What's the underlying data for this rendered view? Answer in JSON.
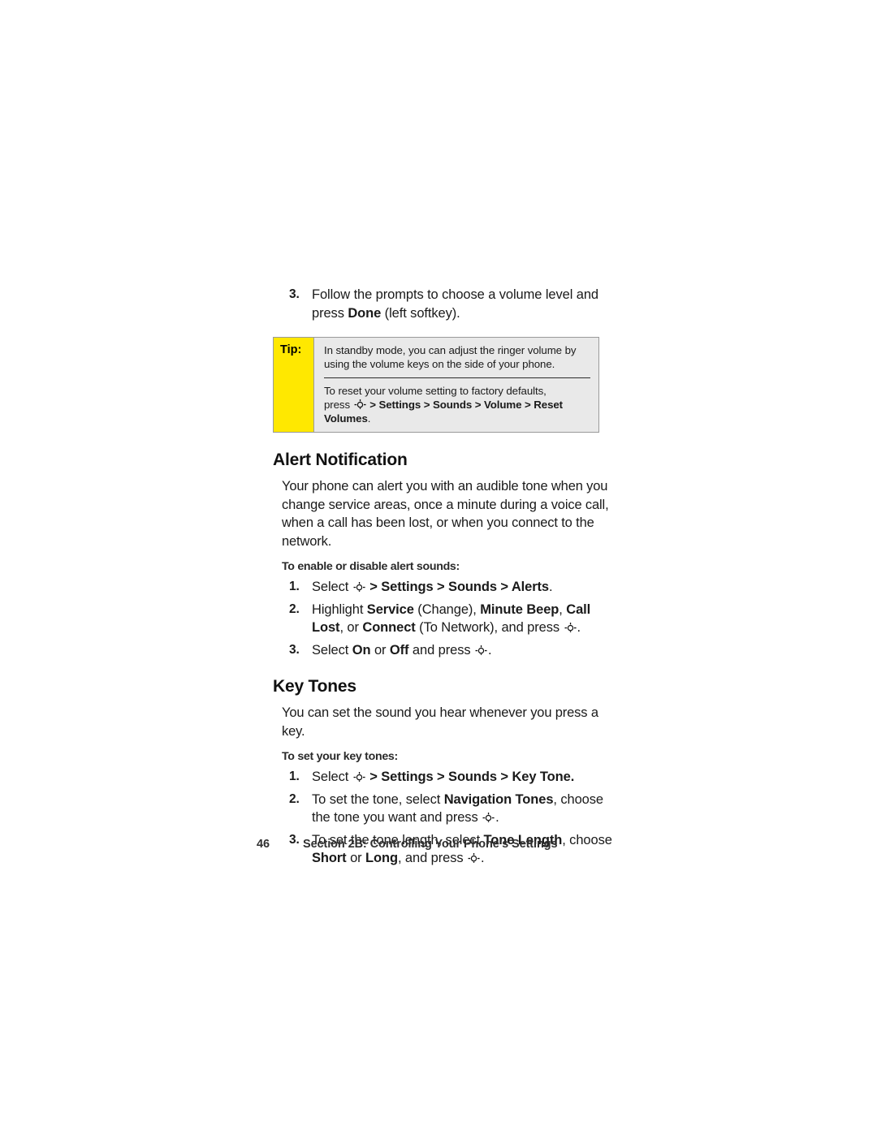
{
  "page": {
    "number": "46",
    "footer_text": "Section 2B: Controlling Your Phone’s Settings",
    "nav_icon_name": "navigation-key-icon"
  },
  "top_step": {
    "num": "3.",
    "line1": "Follow the prompts to choose a volume level and press ",
    "bold1": "Done",
    "line2": " (left softkey)."
  },
  "tip": {
    "label": "Tip:",
    "para1": "In standby mode, you can adjust the ringer volume by using the volume keys on the side of your phone.",
    "para2_pre": "To reset your volume setting to factory defaults,",
    "para2_press": "press ",
    "para2_path": " > Settings > Sounds > Volume > Reset Volumes",
    "para2_end": "."
  },
  "alert": {
    "heading": "Alert Notification",
    "body": "Your phone can alert you with an audible tone when you change service areas, once a minute during a voice call, when a call has been lost, or when you connect to the network.",
    "subhead": "To enable or disable alert sounds:",
    "steps": [
      {
        "num": "1.",
        "pre": "Select ",
        "path": " > Settings > Sounds > Alerts",
        "post": "."
      },
      {
        "num": "2.",
        "pre": "Highlight ",
        "b1": "Service",
        "m1": " (Change), ",
        "b2": "Minute Beep",
        "m2": ", ",
        "b3": "Call Lost",
        "m3": ", or ",
        "b4": "Connect",
        "m4": " (To Network), and press ",
        "post": "."
      },
      {
        "num": "3.",
        "pre": "Select ",
        "b1": "On",
        "m1": " or ",
        "b2": "Off",
        "m2": " and press ",
        "post": "."
      }
    ]
  },
  "keytones": {
    "heading": "Key Tones",
    "body": "You can set the sound you hear whenever you press a key.",
    "subhead": "To set your key tones:",
    "steps": [
      {
        "num": "1.",
        "pre": "Select ",
        "path": " > Settings > Sounds > Key Tone.",
        "post": ""
      },
      {
        "num": "2.",
        "pre": "To set the tone, select ",
        "b1": "Navigation Tones",
        "m1": ", choose the tone you want and press ",
        "post": "."
      },
      {
        "num": "3.",
        "pre": "To set the tone length, select ",
        "b1": "Tone Length",
        "m1": ", choose ",
        "b2": "Short",
        "m2": " or ",
        "b3": "Long",
        "m3": ", and press ",
        "post": "."
      }
    ]
  },
  "colors": {
    "tip_label_bg": "#ffe800",
    "tip_body_bg": "#e9e9e9",
    "border": "#9a9a9a",
    "text": "#1a1a1a"
  }
}
